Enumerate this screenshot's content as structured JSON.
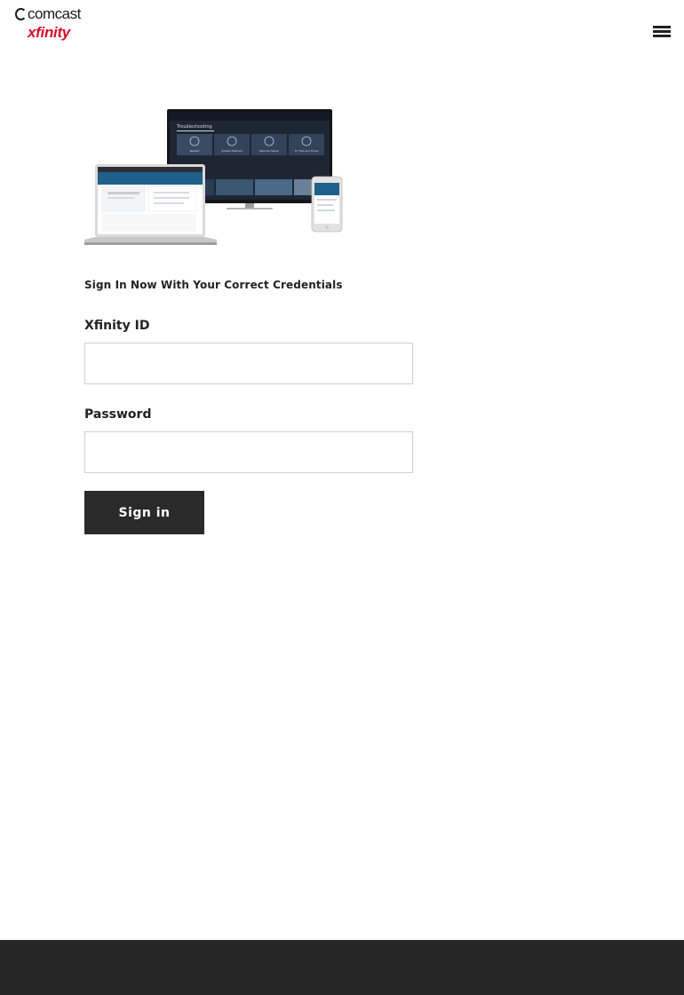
{
  "brand": {
    "parent_name": "comcast",
    "product_name": "xfinity",
    "product_color": "#d6102c"
  },
  "header": {
    "menu_icon": "hamburger-menu-icon"
  },
  "hero": {
    "image": "devices-illustration",
    "tv_screen_title": "Troubleshooting",
    "tv_tiles": [
      "Restart",
      "System Refresh",
      "Remote Setup",
      "TV Tips and Tricks"
    ]
  },
  "form": {
    "subtitle": "Sign In Now With Your Correct Credentials",
    "id_label": "Xfinity ID",
    "id_value": "",
    "password_label": "Password",
    "password_value": "",
    "submit_label": "Sign in"
  },
  "colors": {
    "button_bg": "#2a2a2a",
    "footer_bg": "#262626",
    "input_border": "#cfcfcf"
  }
}
